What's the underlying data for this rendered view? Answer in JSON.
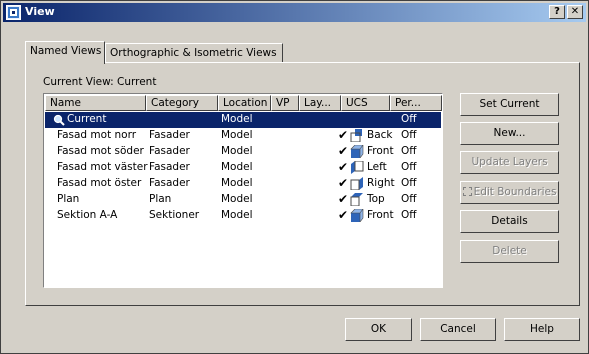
{
  "window": {
    "title": "View"
  },
  "titlebar_buttons": {
    "help": "?",
    "close": "✕"
  },
  "tabs": [
    {
      "label": "Named Views",
      "active": true
    },
    {
      "label": "Orthographic & Isometric Views",
      "active": false
    }
  ],
  "current_view": {
    "label": "Current View:",
    "value": "Current"
  },
  "columns": [
    "Name",
    "Category",
    "Location",
    "VP",
    "Lay...",
    "UCS",
    "Per..."
  ],
  "rows": [
    {
      "name": "Current",
      "category": "",
      "location": "Model",
      "vp": "",
      "layers": "",
      "ucs": "",
      "perspective": "Off",
      "selected": true
    },
    {
      "name": "Fasad mot norr",
      "category": "Fasader",
      "location": "Model",
      "vp": "",
      "layers": "✔",
      "ucs": "Back",
      "perspective": "Off"
    },
    {
      "name": "Fasad mot söder",
      "category": "Fasader",
      "location": "Model",
      "vp": "",
      "layers": "✔",
      "ucs": "Front",
      "perspective": "Off"
    },
    {
      "name": "Fasad mot väster",
      "category": "Fasader",
      "location": "Model",
      "vp": "",
      "layers": "✔",
      "ucs": "Left",
      "perspective": "Off"
    },
    {
      "name": "Fasad mot öster",
      "category": "Fasader",
      "location": "Model",
      "vp": "",
      "layers": "✔",
      "ucs": "Right",
      "perspective": "Off"
    },
    {
      "name": "Plan",
      "category": "Plan",
      "location": "Model",
      "vp": "",
      "layers": "✔",
      "ucs": "Top",
      "perspective": "Off"
    },
    {
      "name": "Sektion A-A",
      "category": "Sektioner",
      "location": "Model",
      "vp": "",
      "layers": "✔",
      "ucs": "Front",
      "perspective": "Off"
    }
  ],
  "side_buttons": {
    "set_current": "Set Current",
    "new": "New...",
    "update_layers": "Update Layers",
    "edit_boundaries": "Edit Boundaries",
    "details": "Details",
    "delete": "Delete"
  },
  "footer_buttons": {
    "ok": "OK",
    "cancel": "Cancel",
    "help": "Help"
  },
  "colors": {
    "title_bar": "#0a246a",
    "selection": "#0a246a",
    "face": "#d4d0c8"
  }
}
